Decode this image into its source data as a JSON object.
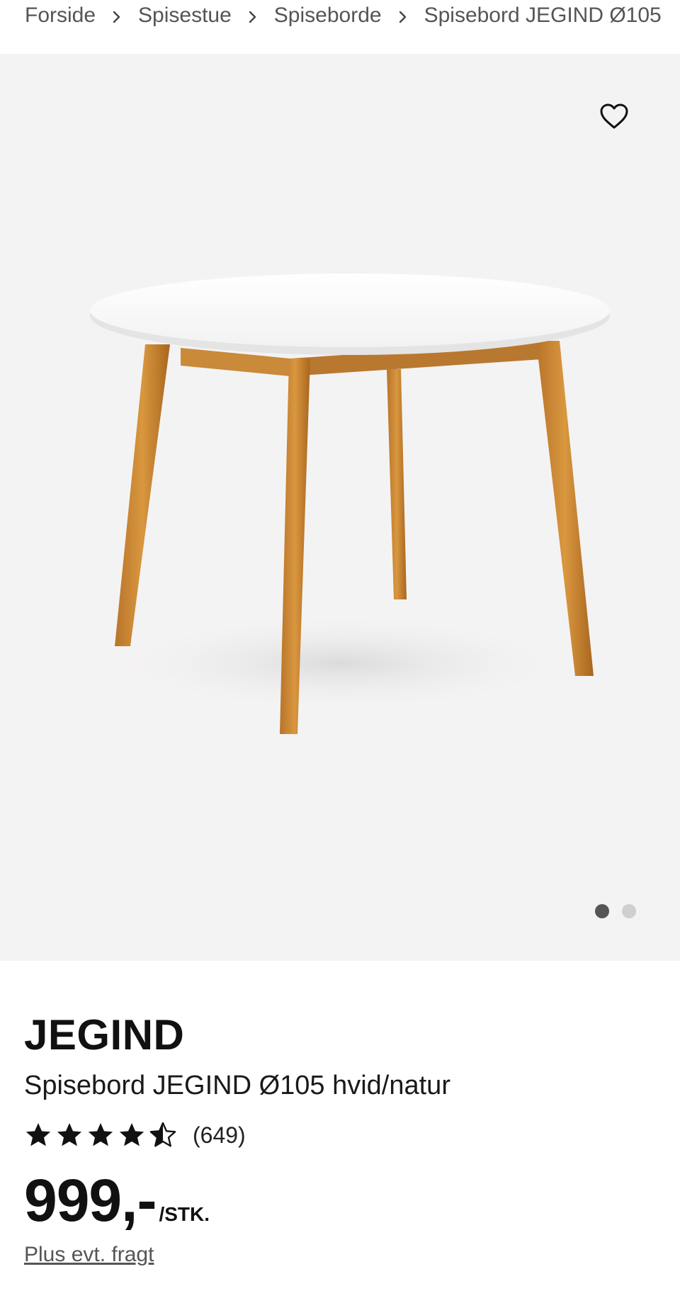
{
  "breadcrumb": {
    "items": [
      {
        "label": "Forside"
      },
      {
        "label": "Spisestue"
      },
      {
        "label": "Spiseborde"
      },
      {
        "label": "Spisebord JEGIND Ø105"
      }
    ]
  },
  "gallery": {
    "favorite_icon": "heart-icon",
    "slide_count": 2,
    "active_slide": 1,
    "background_color": "#f4f3f3"
  },
  "product": {
    "brand": "JEGIND",
    "name": "Spisebord JEGIND Ø105 hvid/natur",
    "rating": {
      "value": 4.5,
      "max": 5,
      "count_label": "(649)"
    },
    "price": "999,-",
    "unit": "/STK.",
    "shipping_link": "Plus evt. fragt"
  }
}
